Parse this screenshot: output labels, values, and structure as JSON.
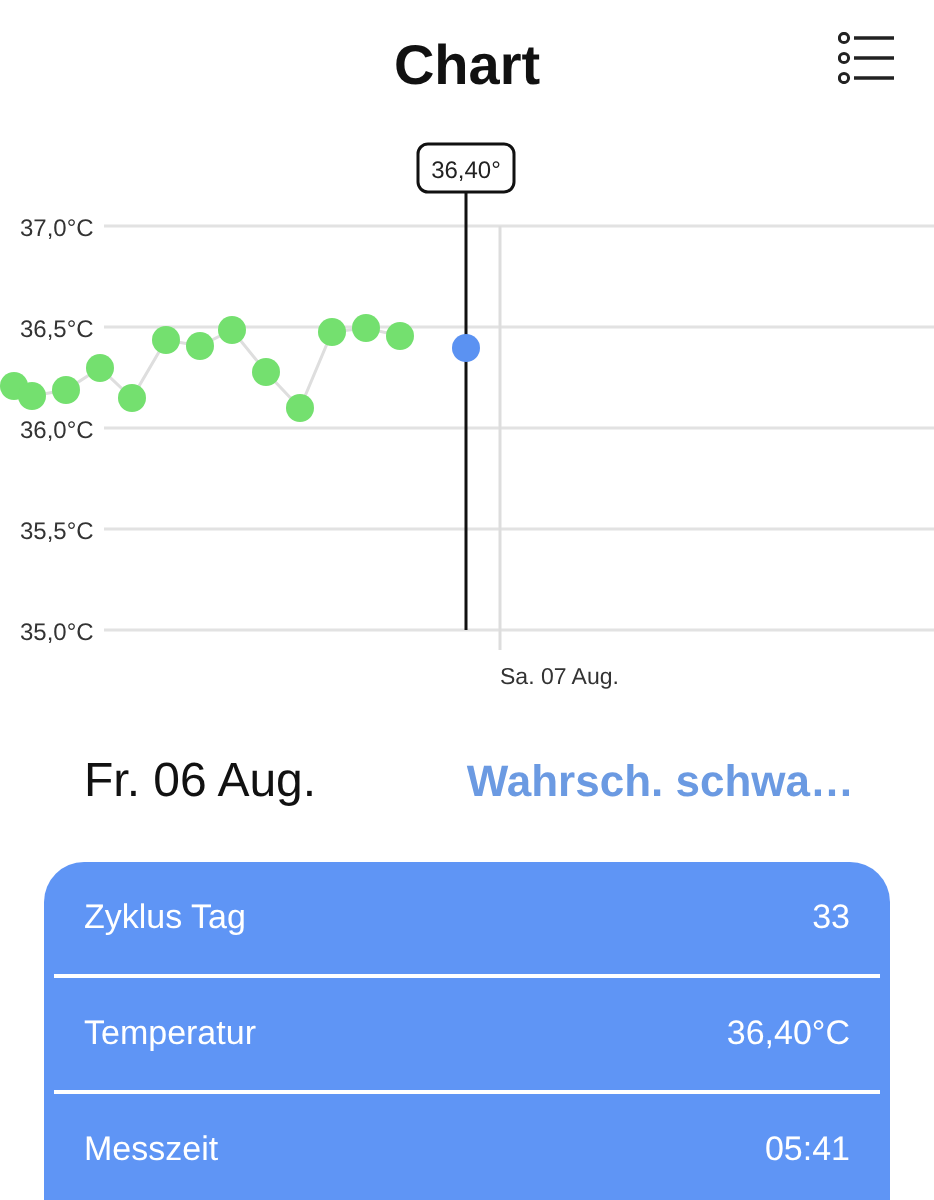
{
  "header": {
    "title": "Chart"
  },
  "chart": {
    "y_labels": [
      "37,0°C",
      "36,5°C",
      "36,0°C",
      "35,5°C",
      "35,0°C"
    ],
    "tooltip": "36,40°",
    "date_label": "Sa. 07 Aug."
  },
  "day": {
    "date": "Fr. 06 Aug.",
    "status": "Wahrsch. schwa…"
  },
  "details": [
    {
      "label": "Zyklus Tag",
      "value": "33"
    },
    {
      "label": "Temperatur",
      "value": "36,40°C"
    },
    {
      "label": "Messzeit",
      "value": "05:41"
    }
  ]
}
